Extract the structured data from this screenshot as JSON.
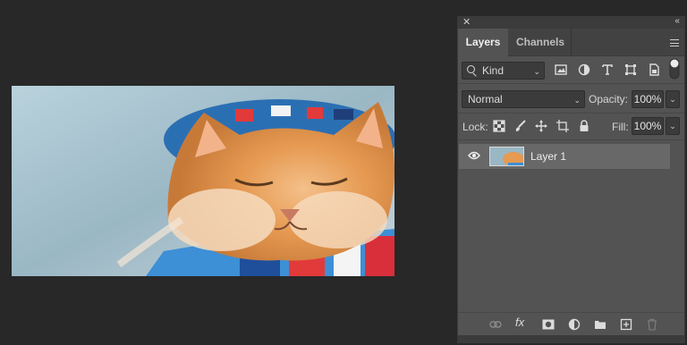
{
  "panel": {
    "close_glyph": "✕",
    "collapse_glyph": "‹‹",
    "tabs": [
      {
        "label": "Layers",
        "active": true
      },
      {
        "label": "Channels",
        "active": false
      }
    ]
  },
  "filter": {
    "kind_label": "Kind",
    "icons": [
      "image-filter-icon",
      "adjustment-filter-icon",
      "type-filter-icon",
      "shape-filter-icon",
      "smart-object-filter-icon",
      "filter-toggle-icon"
    ]
  },
  "blend": {
    "mode": "Normal",
    "opacity_label": "Opacity:",
    "opacity_value": "100%"
  },
  "lock": {
    "label": "Lock:",
    "icons": [
      "lock-transparent-pixels-icon",
      "lock-image-pixels-icon",
      "lock-position-icon",
      "lock-artboard-icon",
      "lock-all-icon"
    ],
    "fill_label": "Fill:",
    "fill_value": "100%"
  },
  "layers": [
    {
      "name": "Layer 1",
      "visible": true,
      "selected": true
    }
  ],
  "bottom_icons": [
    "link-layers-icon",
    "layer-style-fx-icon",
    "add-mask-icon",
    "new-adjustment-layer-icon",
    "new-group-icon",
    "new-layer-icon",
    "delete-layer-icon"
  ],
  "colors": {
    "app_bg": "#282828",
    "panel_bg": "#535353",
    "selected_layer": "#686868"
  }
}
